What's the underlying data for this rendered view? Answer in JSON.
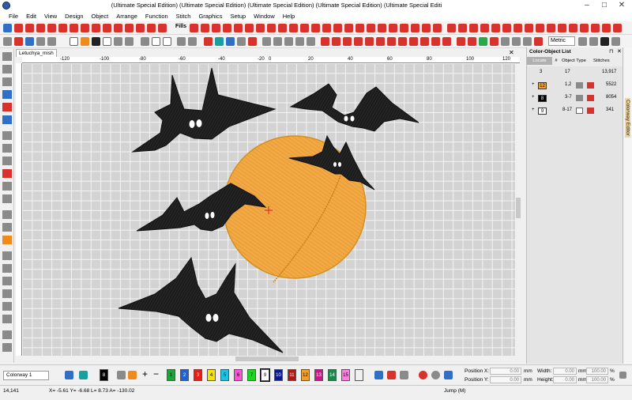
{
  "window": {
    "title": "(Ultimate Special Edition) (Ultimate Special Edition) (Ultimate Special Edition) (Ultimate Special Edition) (Ultimate Special Editi"
  },
  "menu": [
    "File",
    "Edit",
    "View",
    "Design",
    "Object",
    "Arrange",
    "Function",
    "Stitch",
    "Graphics",
    "Setup",
    "Window",
    "Help"
  ],
  "toolbar": {
    "fills_label": "Fills",
    "units": "Metric"
  },
  "document": {
    "tab_name": "Letuchya_mish"
  },
  "ruler": {
    "ticks": [
      "-120",
      "-100",
      "-80",
      "-60",
      "-40",
      "-20",
      "0",
      "20",
      "40",
      "60",
      "80",
      "100",
      "120"
    ]
  },
  "panel": {
    "title": "Color-Object List",
    "headers": {
      "locate": "Locate",
      "num": "#",
      "type": "Object Type",
      "stitches": "Stitches"
    },
    "total": {
      "num": "3",
      "objects": "17",
      "stitches": "13,917"
    },
    "rows": [
      {
        "badge": "12",
        "objects": "1,2",
        "stitches": "5522",
        "color": "#f0a030"
      },
      {
        "badge": "8",
        "objects": "3-7",
        "stitches": "8054",
        "color": "#000000"
      },
      {
        "badge": "9",
        "objects": "8-17",
        "stitches": "341",
        "color": "#ffffff"
      }
    ],
    "side_tab": "Colorway Editor"
  },
  "bottom": {
    "colorway": "Colorway 1",
    "swatches": [
      {
        "label": "8",
        "color": "#000000"
      },
      {
        "label": "1",
        "color": "#1ea33b"
      },
      {
        "label": "2",
        "color": "#1e62d4"
      },
      {
        "label": "3",
        "color": "#e0201a"
      },
      {
        "label": "4",
        "color": "#f6e400"
      },
      {
        "label": "5",
        "color": "#22c0e0"
      },
      {
        "label": "6",
        "color": "#ff52d8"
      },
      {
        "label": "7",
        "color": "#1ed61e"
      },
      {
        "label": "9",
        "color": "#ffffff"
      },
      {
        "label": "10",
        "color": "#0c1a8c"
      },
      {
        "label": "11",
        "color": "#b01818"
      },
      {
        "label": "12",
        "color": "#f0a030"
      },
      {
        "label": "13",
        "color": "#c8188c"
      },
      {
        "label": "14",
        "color": "#1a8a4a"
      },
      {
        "label": "15",
        "color": "#ff7ee0"
      }
    ],
    "position_x_label": "Position X:",
    "position_y_label": "Position Y:",
    "position_x": "0.00",
    "position_y": "0.00",
    "width_label": "Width:",
    "height_label": "Height:",
    "width_mm": "0.00",
    "height_mm": "0.00",
    "width_pct": "100.00",
    "height_pct": "100.00",
    "unit_mm": "mm",
    "unit_pct": "%"
  },
  "status": {
    "stitch_count": "14,141",
    "coords": "X= -5.61 Y= -6.68 L= 8.73 A= -130.02",
    "mode": "Jump (M)"
  }
}
